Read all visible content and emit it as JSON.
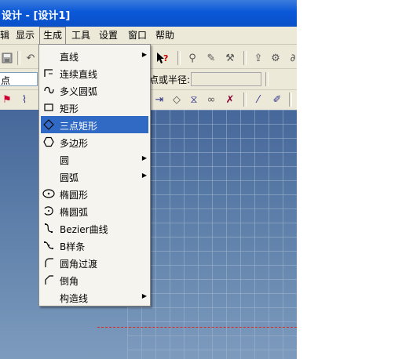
{
  "window": {
    "title": "设计 - [设计1]"
  },
  "menubar": {
    "items": [
      {
        "label": "辑"
      },
      {
        "label": "显示"
      },
      {
        "label": "生成"
      },
      {
        "label": "工具"
      },
      {
        "label": "设置"
      },
      {
        "label": "窗口"
      },
      {
        "label": "帮助"
      }
    ]
  },
  "property_bar": {
    "left_field_label": "点",
    "radius_label": "点或半径:",
    "radius_value": ""
  },
  "icons": {
    "save": "save-icon",
    "undo": "undo-icon",
    "help": "context-help-icon"
  },
  "generate_menu": {
    "items": [
      {
        "label": "直线",
        "icon": "",
        "submenu": true
      },
      {
        "label": "连续直线",
        "icon": "polyline-icon",
        "submenu": false
      },
      {
        "label": "多义圆弧",
        "icon": "poly-arc-icon",
        "submenu": false
      },
      {
        "label": "矩形",
        "icon": "rectangle-icon",
        "submenu": false
      },
      {
        "label": "三点矩形",
        "icon": "three-point-rectangle-icon",
        "submenu": false,
        "highlighted": true
      },
      {
        "label": "多边形",
        "icon": "polygon-icon",
        "submenu": false
      },
      {
        "label": "圆",
        "icon": "",
        "submenu": true
      },
      {
        "label": "圆弧",
        "icon": "",
        "submenu": true
      },
      {
        "label": "椭圆形",
        "icon": "ellipse-icon",
        "submenu": false
      },
      {
        "label": "椭圆弧",
        "icon": "elliptic-arc-icon",
        "submenu": false
      },
      {
        "label": "Bezier曲线",
        "icon": "bezier-curve-icon",
        "submenu": false
      },
      {
        "label": "B样条",
        "icon": "b-spline-icon",
        "submenu": false
      },
      {
        "label": "圆角过渡",
        "icon": "fillet-icon",
        "submenu": false
      },
      {
        "label": "倒角",
        "icon": "chamfer-icon",
        "submenu": false
      },
      {
        "label": "构造线",
        "icon": "",
        "submenu": true
      }
    ]
  }
}
